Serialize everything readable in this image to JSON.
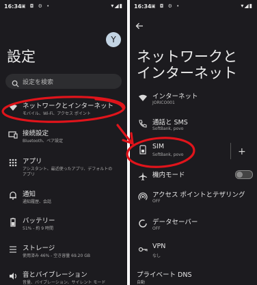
{
  "left": {
    "status": {
      "time": "16:34",
      "notif": "▣ ◘ ⚙ •",
      "sys": "▾◢▮"
    },
    "avatar": "Y",
    "title": "設定",
    "search_placeholder": "設定を検索",
    "items": [
      {
        "title": "ネットワークとインターネット",
        "sub": "モバイル、Wi-Fi、アクセス ポイント",
        "icon": "wifi-icon"
      },
      {
        "title": "接続設定",
        "sub": "Bluetooth、ペア設定",
        "icon": "devices-icon"
      },
      {
        "title": "アプリ",
        "sub": "アシスタント、最近使ったアプリ、デフォルトの",
        "sub2": "アプリ",
        "icon": "apps-icon"
      },
      {
        "title": "通知",
        "sub": "通知履歴、会話",
        "icon": "bell-icon"
      },
      {
        "title": "バッテリー",
        "sub": "51% - 約 9 時間",
        "icon": "battery-icon"
      },
      {
        "title": "ストレージ",
        "sub": "使用済み 46% - 空き容量 69.20 GB",
        "icon": "storage-icon"
      },
      {
        "title": "音とバイブレーション",
        "sub": "音量、バイブレーション、サイレント モード",
        "icon": "sound-icon"
      }
    ]
  },
  "right": {
    "status": {
      "time": "16:34",
      "notif": "▣ ◘ ⚙ •",
      "sys": "▾◢▮"
    },
    "title_line1": "ネットワークと",
    "title_line2": "インターネット",
    "items": [
      {
        "title": "インターネット",
        "sub": "JORICO001",
        "icon": "wifi-icon"
      },
      {
        "title": "通話と SMS",
        "sub": "SoftBank, povo",
        "icon": "call-sms-icon"
      },
      {
        "title": "SIM",
        "sub": "SoftBank, povo",
        "icon": "sim-icon"
      },
      {
        "title": "機内モード",
        "sub": "",
        "icon": "airplane-icon"
      },
      {
        "title": "アクセス ポイントとテザリング",
        "sub": "OFF",
        "icon": "hotspot-icon"
      },
      {
        "title": "データセーバー",
        "sub": "OFF",
        "icon": "data-saver-icon"
      },
      {
        "title": "VPN",
        "sub": "なし",
        "icon": "vpn-icon"
      },
      {
        "title": "プライベート DNS",
        "sub": "自動",
        "icon": "dns-icon"
      }
    ],
    "plus": "+",
    "airplane_toggle": "off"
  },
  "annotation_color": "#e0141b"
}
